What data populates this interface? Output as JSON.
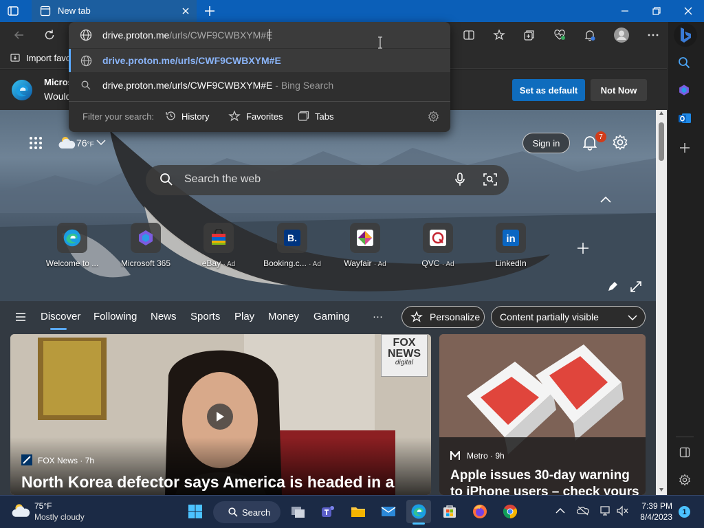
{
  "browser": {
    "tab_title": "New tab",
    "address_value": "drive.proton.me/urls/CWF9CWBXYM#E",
    "address_host": "drive.proton.me",
    "address_path": "/urls/CWF9CWBXYM#E",
    "favorites_label": "Import favo"
  },
  "dropdown": {
    "suggestion_url": "drive.proton.me/urls/CWF9CWBXYM#E",
    "search_query": "drive.proton.me/urls/CWF9CWBXYM#E",
    "search_suffix": "- Bing Search",
    "filter_label": "Filter your search:",
    "filters": [
      "History",
      "Favorites",
      "Tabs"
    ]
  },
  "banner": {
    "title": "Micros",
    "subtitle": "Would",
    "set_default": "Set as default",
    "not_now": "Not Now"
  },
  "hero": {
    "weather": "76",
    "weather_unit": "°F",
    "sign_in": "Sign in",
    "notifications": "7",
    "search_placeholder": "Search the web"
  },
  "tiles": [
    {
      "label": "Welcome to ...",
      "ad": ""
    },
    {
      "label": "Microsoft 365",
      "ad": ""
    },
    {
      "label": "eBay",
      "ad": "· Ad"
    },
    {
      "label": "Booking.c...",
      "ad": "· Ad"
    },
    {
      "label": "Wayfair",
      "ad": "· Ad"
    },
    {
      "label": "QVC",
      "ad": "· Ad"
    },
    {
      "label": "LinkedIn",
      "ad": ""
    }
  ],
  "feed_nav": {
    "items": [
      "Discover",
      "Following",
      "News",
      "Sports",
      "Play",
      "Money",
      "Gaming"
    ],
    "more": "···",
    "personalize": "Personalize",
    "content_visibility": "Content partially visible"
  },
  "cards": [
    {
      "source": "FOX News",
      "age": "7h",
      "headline": "North Korea defector says America is headed in a",
      "logo_line1": "FOX",
      "logo_line2": "NEWS",
      "logo_line3": "digital"
    },
    {
      "source": "Metro",
      "age": "9h",
      "headline": "Apple issues 30-day warning to iPhone users – check yours"
    }
  ],
  "taskbar": {
    "temp": "75°F",
    "condition": "Mostly cloudy",
    "search_label": "Search",
    "time": "7:39 PM",
    "date": "8/4/2023",
    "notification_count": "1"
  },
  "colors": {
    "accent": "#0f6cbd",
    "titlebar": "#0b5fb8",
    "taskbar": "#1b2a45"
  }
}
